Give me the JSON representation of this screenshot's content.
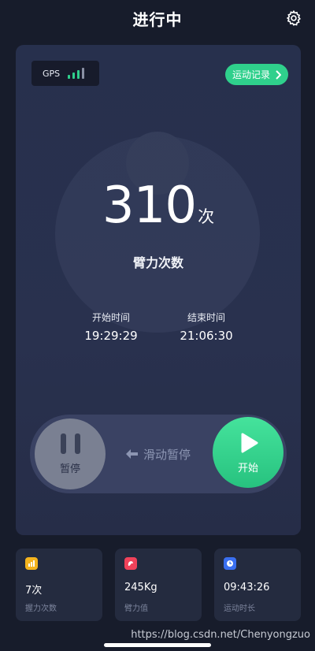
{
  "header": {
    "title": "进行中"
  },
  "gps": {
    "label": "GPS",
    "signal_bars": 4,
    "signal_level": 3
  },
  "record_button": {
    "label": "运动记录"
  },
  "counter": {
    "value": "310",
    "unit": "次",
    "label": "臂力次数"
  },
  "start_time": {
    "label": "开始时间",
    "value": "19:29:29"
  },
  "end_time": {
    "label": "结束时间",
    "value": "21:06:30"
  },
  "controls": {
    "pause_label": "暂停",
    "slide_hint": "滑动暂停",
    "start_label": "开始"
  },
  "stats": [
    {
      "icon": "bar-chart-icon",
      "color": "#f5b41e",
      "value": "7次",
      "label": "握力次数"
    },
    {
      "icon": "arm-icon",
      "color": "#f0425a",
      "value": "245Kg",
      "label": "臂力值"
    },
    {
      "icon": "clock-icon",
      "color": "#3a6ff0",
      "value": "09:43:26",
      "label": "运动时长"
    }
  ],
  "watermark": "https://blog.csdn.net/Chenyongzuo",
  "colors": {
    "accent": "#2fd08c",
    "background": "#171c2b",
    "card": "#28304d"
  }
}
